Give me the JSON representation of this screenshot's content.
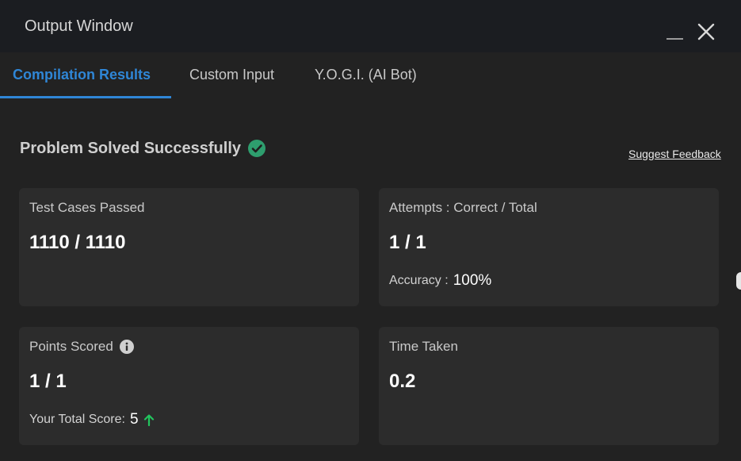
{
  "window": {
    "title": "Output Window"
  },
  "tabs": [
    {
      "label": "Compilation Results",
      "active": true
    },
    {
      "label": "Custom Input",
      "active": false
    },
    {
      "label": "Y.O.G.I. (AI Bot)",
      "active": false
    }
  ],
  "result": {
    "status": "Problem Solved Successfully",
    "feedback_link": "Suggest Feedback"
  },
  "cards": {
    "test_cases": {
      "label": "Test Cases Passed",
      "value": "1110 / 1110"
    },
    "attempts": {
      "label": "Attempts : Correct / Total",
      "value": "1 / 1",
      "accuracy_label": "Accuracy :",
      "accuracy_value": "100%"
    },
    "points": {
      "label": "Points Scored",
      "value": "1 / 1",
      "total_label": "Your Total Score:",
      "total_value": "5"
    },
    "time": {
      "label": "Time Taken",
      "value": "0.2"
    }
  },
  "colors": {
    "accent": "#2f86d6",
    "success": "#2e9e6e",
    "score_up": "#22c55e",
    "card_bg": "#2c2c2c",
    "page_bg": "#222222",
    "titlebar_bg": "#1b1d21"
  },
  "icons": {
    "status": "check-circle-icon",
    "points_info": "info-icon",
    "score_trend": "arrow-up-icon",
    "minimize": "minimize-icon",
    "close": "close-icon"
  }
}
